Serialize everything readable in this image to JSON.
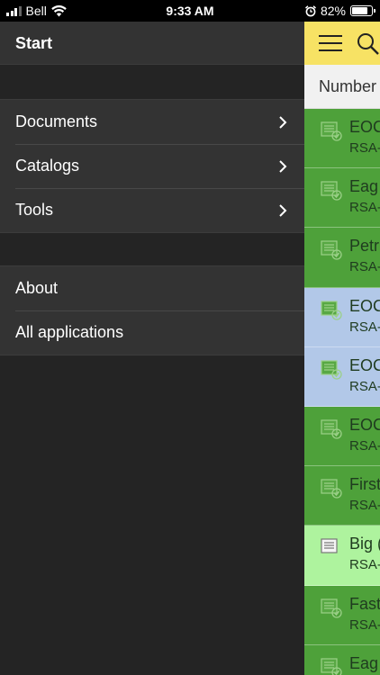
{
  "status_bar": {
    "carrier": "Bell",
    "time": "9:33 AM",
    "battery_level": "82%",
    "battery_fraction": 0.82,
    "icons": [
      "signal-icon",
      "wifi-icon",
      "alarm-icon",
      "battery-icon"
    ]
  },
  "drawer": {
    "header": "Start",
    "nav_items": [
      {
        "label": "Documents",
        "icon": "chevron-right-icon"
      },
      {
        "label": "Catalogs",
        "icon": "chevron-right-icon"
      },
      {
        "label": "Tools",
        "icon": "chevron-right-icon"
      }
    ],
    "secondary_items": [
      {
        "label": "About"
      },
      {
        "label": "All applications"
      }
    ]
  },
  "main": {
    "toolbar": {
      "menu_icon": "hamburger-menu-icon",
      "search_icon": "search-icon",
      "color": "#f7e264"
    },
    "column_header": "Number",
    "rows": [
      {
        "title": "EOC",
        "subtitle": "RSA-",
        "color": "#4ea13a",
        "icon": "document-check-icon"
      },
      {
        "title": "Eag",
        "subtitle": "RSA-",
        "color": "#4ea13a",
        "icon": "document-check-icon"
      },
      {
        "title": "Petr",
        "subtitle": "RSA-",
        "color": "#4ea13a",
        "icon": "document-check-icon"
      },
      {
        "title": "EOC",
        "subtitle": "RSA-",
        "color": "#b2c8e8",
        "icon": "document-check-icon"
      },
      {
        "title": "EOC",
        "subtitle": "RSA-",
        "color": "#b2c8e8",
        "icon": "document-check-icon"
      },
      {
        "title": "EOC",
        "subtitle": "RSA-",
        "color": "#4ea13a",
        "icon": "document-check-icon"
      },
      {
        "title": "First",
        "subtitle": "RSA-",
        "color": "#4ea13a",
        "icon": "document-check-icon"
      },
      {
        "title": "Big (",
        "subtitle": "RSA-",
        "color": "#aef39e",
        "icon": "document-icon"
      },
      {
        "title": "Fast",
        "subtitle": "RSA-",
        "color": "#4ea13a",
        "icon": "document-check-icon"
      },
      {
        "title": "Eag",
        "subtitle": "",
        "color": "#4ea13a",
        "icon": "document-check-icon"
      }
    ]
  }
}
